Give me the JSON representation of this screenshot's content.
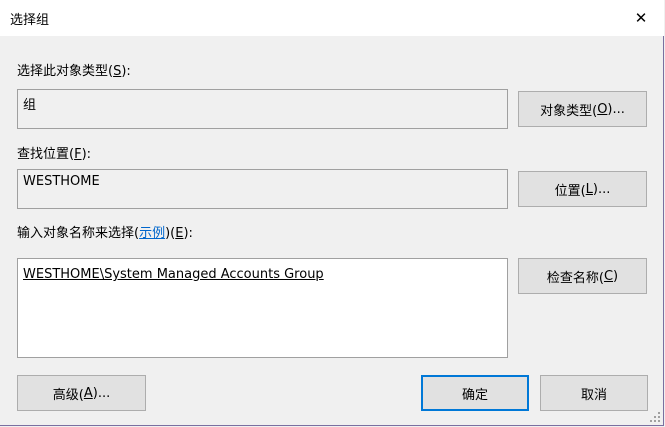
{
  "window": {
    "title": "选择组",
    "close_glyph": "✕"
  },
  "object_type": {
    "label_prefix": "选择此对象类型(",
    "label_key": "S",
    "label_suffix": "):",
    "value": "组",
    "button": {
      "prefix": "对象类型(",
      "key": "O",
      "suffix": ")..."
    }
  },
  "location": {
    "label_prefix": "查找位置(",
    "label_key": "F",
    "label_suffix": "):",
    "value": "WESTHOME",
    "button": {
      "prefix": "位置(",
      "key": "L",
      "suffix": ")..."
    }
  },
  "names": {
    "label_prefix": "输入对象名称来选择(",
    "example_link": "示例",
    "label_mid": ")(",
    "label_key": "E",
    "label_suffix": "):",
    "entered_value": "WESTHOME\\System Managed Accounts Group",
    "check_button": {
      "prefix": "检查名称(",
      "key": "C",
      "suffix": ")"
    }
  },
  "footer": {
    "advanced": {
      "prefix": "高级(",
      "key": "A",
      "suffix": ")..."
    },
    "ok_label": "确定",
    "cancel_label": "取消"
  },
  "colors": {
    "accent": "#0078d7",
    "link": "#0066cc"
  }
}
